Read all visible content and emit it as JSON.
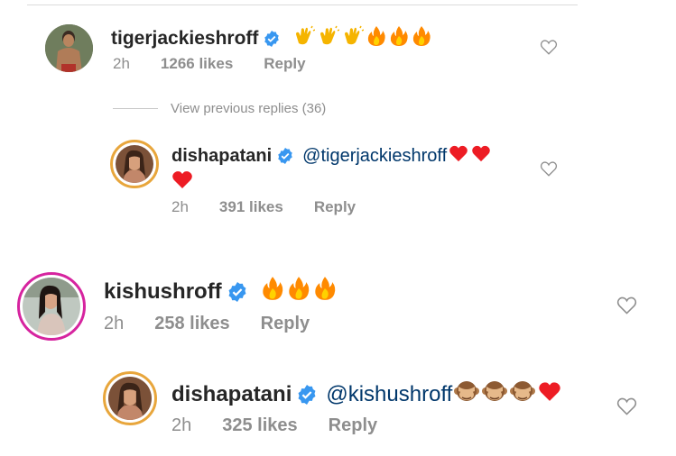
{
  "comments": [
    {
      "username": "tigerjackieshroff",
      "emojis": [
        "clap",
        "clap",
        "clap",
        "fire",
        "fire",
        "fire"
      ],
      "time": "2h",
      "likes": "1266 likes",
      "reply": "Reply"
    },
    {
      "username": "dishapatani",
      "mention": "@tigerjackieshroff",
      "emojis": [
        "heart",
        "heart",
        "heart"
      ],
      "time": "2h",
      "likes": "391 likes",
      "reply": "Reply"
    },
    {
      "username": "kishushroff",
      "emojis": [
        "fire",
        "fire",
        "fire"
      ],
      "time": "2h",
      "likes": "258 likes",
      "reply": "Reply"
    },
    {
      "username": "dishapatani",
      "mention": "@kishushroff",
      "emojis": [
        "see-no-evil-monkey",
        "see-no-evil-monkey",
        "see-no-evil-monkey",
        "heart"
      ],
      "time": "2h",
      "likes": "325 likes",
      "reply": "Reply"
    }
  ],
  "view_previous_replies": "View previous replies (36)",
  "colors": {
    "verified": "#3897f0",
    "mention": "#00376b",
    "meta": "#8e8e8e",
    "heart_red": "#ed1c24",
    "fire": "#ff8a00"
  }
}
